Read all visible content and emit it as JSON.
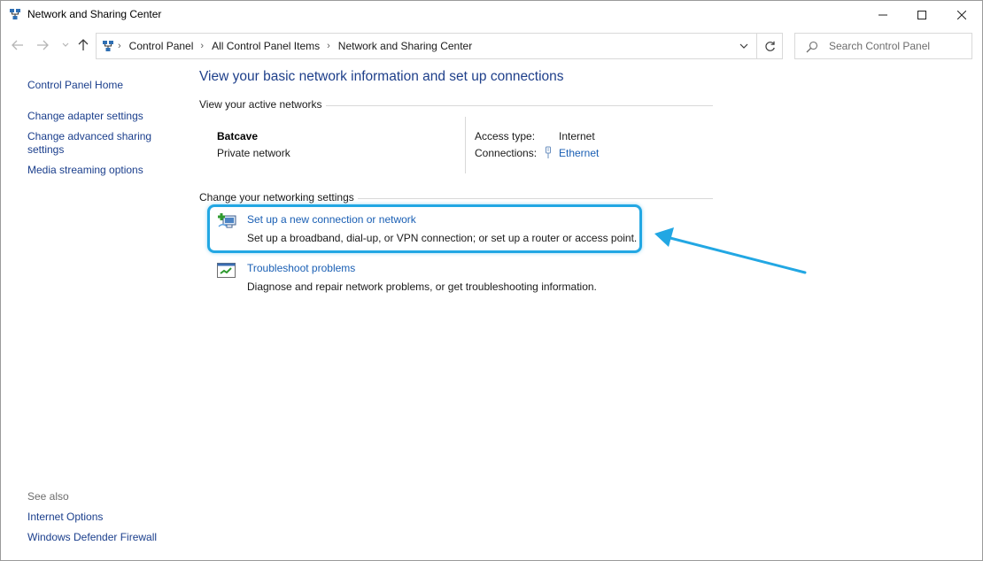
{
  "window": {
    "title": "Network and Sharing Center",
    "icon": "network-icon",
    "controls": [
      "minimize-icon",
      "maximize-icon",
      "close-icon"
    ]
  },
  "navigation": {
    "back_icon": "arrow-left-icon",
    "forward_icon": "arrow-right-icon",
    "recent_icon": "chevron-down-icon",
    "up_icon": "arrow-up-icon"
  },
  "address": {
    "crumbs": [
      "Control Panel",
      "All Control Panel Items",
      "Network and Sharing Center"
    ],
    "refresh_icon": "refresh-icon"
  },
  "search": {
    "placeholder": "Search Control Panel",
    "value": ""
  },
  "sidebar": {
    "links": [
      "Control Panel Home",
      "Change adapter settings",
      "Change advanced sharing settings",
      "Media streaming options"
    ],
    "see_also_heading": "See also",
    "see_also": [
      "Internet Options",
      "Windows Defender Firewall"
    ]
  },
  "main": {
    "title": "View your basic network information and set up connections",
    "active_networks_heading": "View your active networks",
    "network": {
      "name": "Batcave",
      "type": "Private network",
      "access_type_label": "Access type:",
      "access_type_value": "Internet",
      "connections_label": "Connections:",
      "connections_value": "Ethernet"
    },
    "change_heading": "Change your networking settings",
    "tasks": [
      {
        "title": "Set up a new connection or network",
        "description": "Set up a broadband, dial-up, or VPN connection; or set up a router or access point.",
        "icon": "new-connection-icon"
      },
      {
        "title": "Troubleshoot problems",
        "description": "Diagnose and repair network problems, or get troubleshooting information.",
        "icon": "troubleshoot-icon"
      }
    ]
  },
  "annotation": {
    "color": "#22a7e3"
  }
}
